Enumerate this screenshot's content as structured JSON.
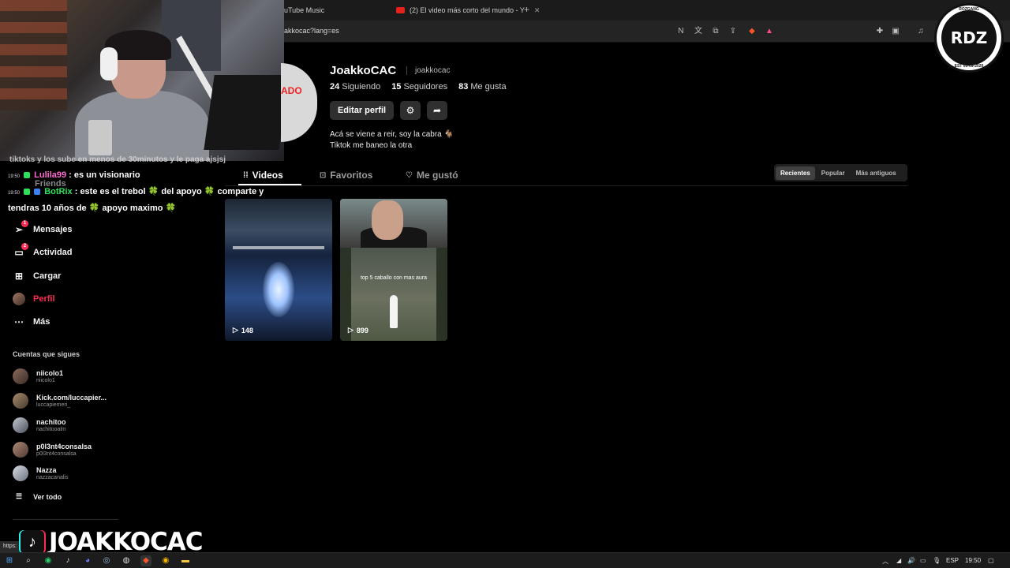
{
  "browser": {
    "tabs": [
      {
        "title": "uTube Music"
      },
      {
        "title": "(2) El video más corto del mundo - Y"
      }
    ],
    "new_tab": "+",
    "url": "akkocac?lang=es"
  },
  "chat": {
    "cut_line": "tiktoks y los sube en menos de 30minutos y le paga ajsjsj",
    "messages": [
      {
        "time": "19:50",
        "user": "Lulila99",
        "text": ": es un visionario"
      },
      {
        "time": "19:50",
        "user": "BotRix",
        "text": ": este es el trebol 🍀 del apoyo 🍀 comparte y"
      },
      {
        "time": "",
        "user": "",
        "text": "tendras 10 años de 🍀 apoyo maximo 🍀"
      }
    ]
  },
  "nav": {
    "ghost_friends": "Friends",
    "items": [
      {
        "label": "Mensajes",
        "icon": "send-icon",
        "badge": "1"
      },
      {
        "label": "Actividad",
        "icon": "activity-icon",
        "badge": "2"
      },
      {
        "label": "Cargar",
        "icon": "upload-icon"
      },
      {
        "label": "Perfil",
        "icon": "avatar"
      },
      {
        "label": "Más",
        "icon": "more-icon"
      }
    ],
    "following_title": "Cuentas que sigues",
    "following": [
      {
        "name": "niicolo1",
        "handle": "niicolo1"
      },
      {
        "name": "Kick.com/luccapier...",
        "handle": "luccapiemeri_"
      },
      {
        "name": "nachitoo",
        "handle": "nachitooalm"
      },
      {
        "name": "p0l3nt4consalsa",
        "handle": "p0l3nt4consalsa"
      },
      {
        "name": "Nazza",
        "handle": "nazzacanalis"
      }
    ],
    "see_all": "Ver todo"
  },
  "profile": {
    "avatar_tag": "ADO",
    "name": "JoakkoCAC",
    "handle": "joakkocac",
    "following_count": "24",
    "following_label": "Siguiendo",
    "followers_count": "15",
    "followers_label": "Seguidores",
    "likes_count": "83",
    "likes_label": "Me gusta",
    "edit_button": "Editar perfil",
    "bio_line1": "Acá se viene a reir, soy la cabra 🐐",
    "bio_line2": "Tiktok me baneo la otra"
  },
  "content_tabs": [
    {
      "label": "Videos",
      "icon": "grid-icon"
    },
    {
      "label": "Favoritos",
      "icon": "bookmark-icon"
    },
    {
      "label": "Me gustó",
      "icon": "heart-icon"
    }
  ],
  "sort": [
    "Recientes",
    "Popular",
    "Más antiguos"
  ],
  "videos": [
    {
      "views": "148",
      "caption": ""
    },
    {
      "views": "899",
      "caption": "top 5 caballo con mas aura"
    }
  ],
  "logo": {
    "text": "RDZ",
    "top": "ROZGANG",
    "bottom": "EST 05-09-2020"
  },
  "overlay": {
    "brand": "JOAKKOCAC",
    "status_url": "https:"
  },
  "taskbar": {
    "lang": "ESP",
    "time": "19:50"
  },
  "colors": {
    "accent": "#fe2c55",
    "bg": "#000000"
  }
}
